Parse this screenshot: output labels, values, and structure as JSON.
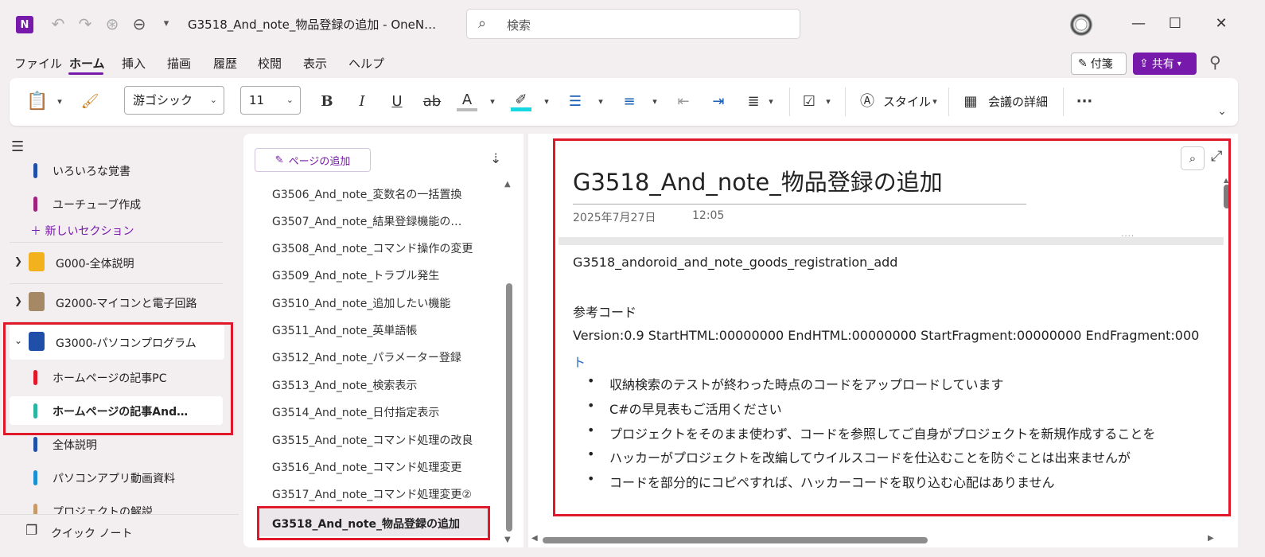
{
  "titlebar": {
    "logo_letter": "N",
    "doc_title": "G3518_And_note_物品登録の追加  -  OneN…",
    "search_placeholder": "検索"
  },
  "menu": {
    "items": [
      "ファイル",
      "ホーム",
      "挿入",
      "描画",
      "履歴",
      "校閲",
      "表示",
      "ヘルプ"
    ],
    "active": "ホーム",
    "note_button": "付箋",
    "share_button": "共有"
  },
  "ribbon": {
    "font_name": "游ゴシック",
    "font_size": "11",
    "bold": "B",
    "italic": "I",
    "underline": "U",
    "strike": "ab",
    "font_color": "A",
    "style_label": "スタイル",
    "meeting_label": "会議の詳細",
    "more": "···"
  },
  "sections_top": [
    {
      "label": "いろいろな覚書",
      "color": "#1f4fa8"
    },
    {
      "label": "ユーチューブ作成",
      "color": "#a0207a"
    }
  ],
  "new_section": "新しいセクション",
  "notebooks": [
    {
      "label": "G000-全体説明",
      "color": "#f2b21e"
    },
    {
      "label": "G2000-マイコンと電子回路",
      "color": "#a58864"
    },
    {
      "label": "G3000-パソコンプログラム",
      "color": "#1f4fa8"
    }
  ],
  "sections_g3000": [
    {
      "label": "ホームページの記事PC",
      "color": "#e0192a"
    },
    {
      "label": "ホームページの記事And…",
      "color": "#2bb3a3"
    },
    {
      "label": "全体説明",
      "color": "#1f4fa8"
    },
    {
      "label": "パソコンアプリ動画資料",
      "color": "#1c8ed6"
    },
    {
      "label": "プロジェクトの解説",
      "color": "#c79a6b"
    }
  ],
  "quick_note": "クイック ノート",
  "add_page": "ページの追加",
  "pages": [
    "G3506_And_note_変数名の一括置換",
    "G3507_And_note_結果登録機能の…",
    "G3508_And_note_コマンド操作の変更",
    "G3509_And_note_トラブル発生",
    "G3510_And_note_追加したい機能",
    "G3511_And_note_英単語帳",
    "G3512_And_note_パラメーター登録",
    "G3513_And_note_検索表示",
    "G3514_And_note_日付指定表示",
    "G3515_And_note_コマンド処理の改良",
    "G3516_And_note_コマンド処理変更",
    "G3517_And_note_コマンド処理変更②",
    "G3518_And_note_物品登録の追加"
  ],
  "page": {
    "title": "G3518_And_note_物品登録の追加",
    "date": "2025年7月27日",
    "time": "12:05",
    "line1": "G3518_andoroid_and_note_goods_registration_add",
    "line2": "参考コード",
    "line3": "Version:0.9 StartHTML:00000000 EndHTML:00000000 StartFragment:00000000 EndFragment:000",
    "line4": "ト",
    "bullets": [
      "収納検索のテストが終わった時点のコードをアップロードしています",
      "C#の早見表もご活用ください",
      "プロジェクトをそのまま使わず、コードを参照してご自身がプロジェクトを新規作成することを",
      "ハッカーがプロジェクトを改編してウイルスコードを仕込むことを防ぐことは出来ませんが",
      "コードを部分的にコピペすれば、ハッカーコードを取り込む心配はありません"
    ]
  },
  "colors": {
    "accent": "#7719aa",
    "highlight": "#e0192a"
  }
}
